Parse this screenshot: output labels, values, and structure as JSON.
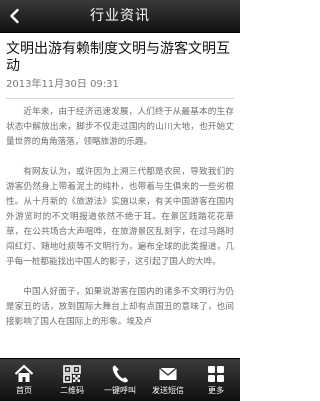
{
  "header": {
    "title": "行业资讯",
    "back_icon": "back-arrow-icon"
  },
  "article": {
    "title": "文明出游有赖制度文明与游客文明互动",
    "date": "2013年11月30日 09:31",
    "paragraphs": [
      "近年来，由于经济迅速发展，人们终于从最基本的生存状态中解放出来，脚步不仅走过国内的山川大地，也开始丈量世界的角角落落，领略旅游的乐趣。",
      "有网友认为，或许因为上溯三代都是农民，导致我们的游客仍然身上带着泥土的纯朴，也带着与生俱来的一些劣根性。从十月新的《旅游法》实施以来，有关中国游客在国内外游览时的不文明报道依然不绝于耳。在景区践踏花花草草，在公共场合大声喧哗，在旅游景区乱刻字，在过马路时闯红灯、随地吐痰等不文明行为，遍布全球的此类报道，几乎每一桩都能找出中国人的影子，这引起了国人的大哗。",
      "中国人好面子，如果说游客在国内的诸多不文明行为仍是家丑的话，放到国际大舞台上却有点国丑的意味了，也间接影响了国人在国际上的形象。埃及卢"
    ]
  },
  "bottom_nav": [
    {
      "label": "首页",
      "icon": "home-icon"
    },
    {
      "label": "二维码",
      "icon": "qr-code-icon"
    },
    {
      "label": "一键呼叫",
      "icon": "phone-icon"
    },
    {
      "label": "发送短信",
      "icon": "envelope-icon"
    },
    {
      "label": "更多",
      "icon": "more-grid-icon"
    }
  ]
}
